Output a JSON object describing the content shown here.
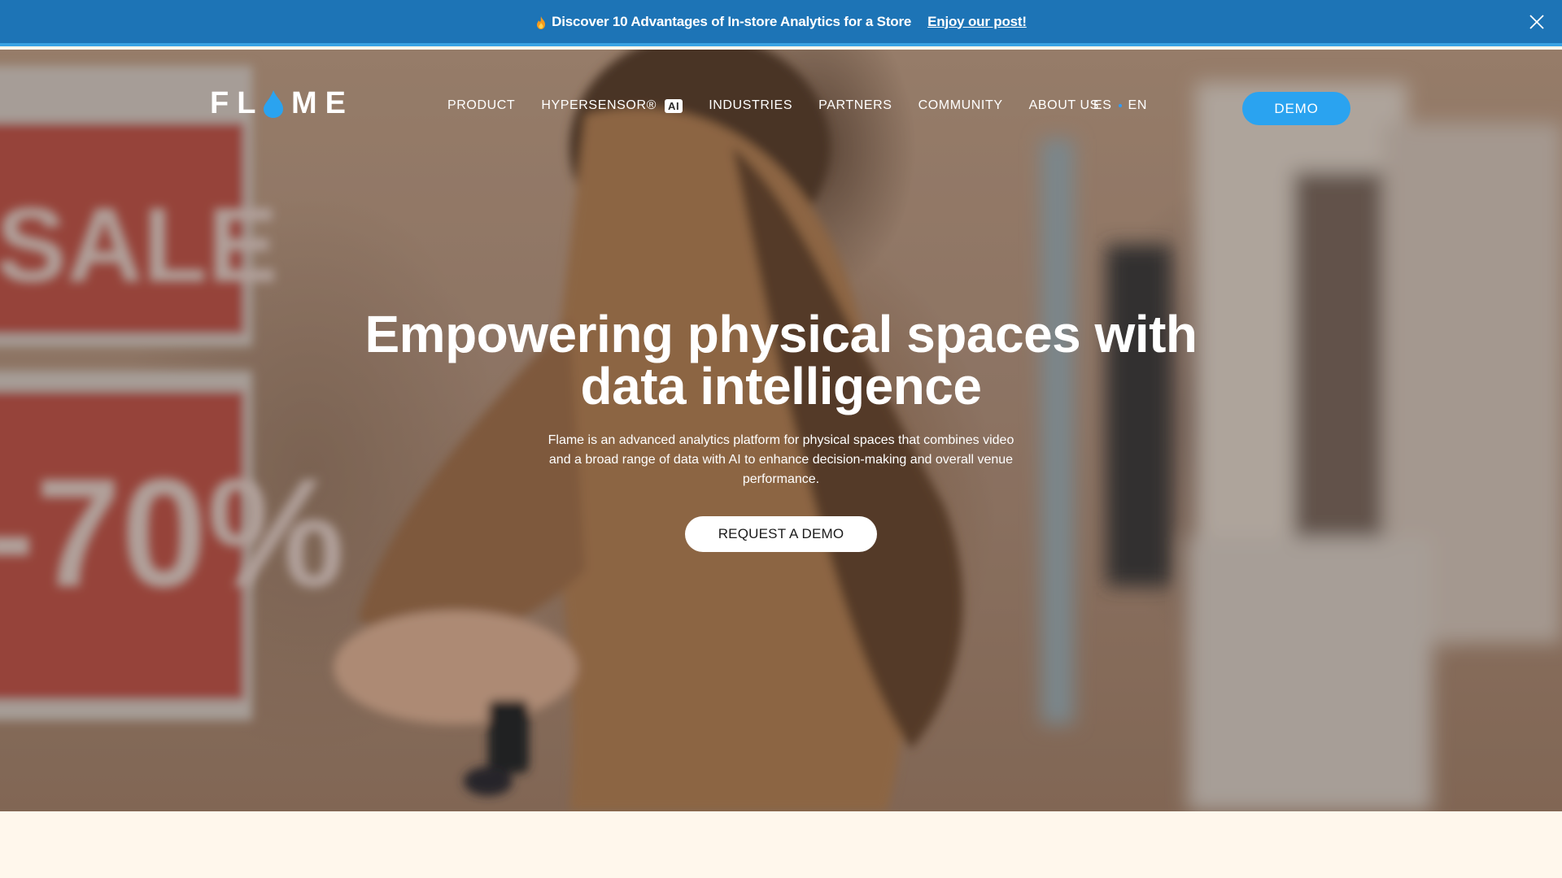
{
  "announcement": {
    "icon": "fire-icon",
    "text": "Discover 10 Advantages of In-store Analytics for a Store",
    "link_text": "Enjoy our post!",
    "close_icon": "close-icon",
    "background_color": "#1d74b6"
  },
  "logo": {
    "text": "FLAME",
    "accent_color": "#2aa3f0"
  },
  "nav": {
    "items": [
      {
        "label": "PRODUCT"
      },
      {
        "label": "HYPERSENSOR®",
        "badge": "AI"
      },
      {
        "label": "INDUSTRIES"
      },
      {
        "label": "PARTNERS"
      },
      {
        "label": "COMMUNITY"
      },
      {
        "label": "ABOUT US"
      }
    ],
    "languages": [
      "ES",
      "EN"
    ],
    "demo_label": "DEMO"
  },
  "hero": {
    "headline_line1": "Empowering physical spaces with",
    "headline_line2": "data intelligence",
    "subtitle_line1": "Flame is an advanced analytics platform for physical spaces that combines video",
    "subtitle_line2": "and a broad range of data with AI to enhance decision-making and overall venue",
    "subtitle_line3": "performance.",
    "cta_label": "REQUEST A DEMO",
    "sign_sale": "SALE",
    "sign_discount": "-70%"
  },
  "colors": {
    "brand_blue": "#2aa3f0",
    "cream": "#fff7ec"
  }
}
